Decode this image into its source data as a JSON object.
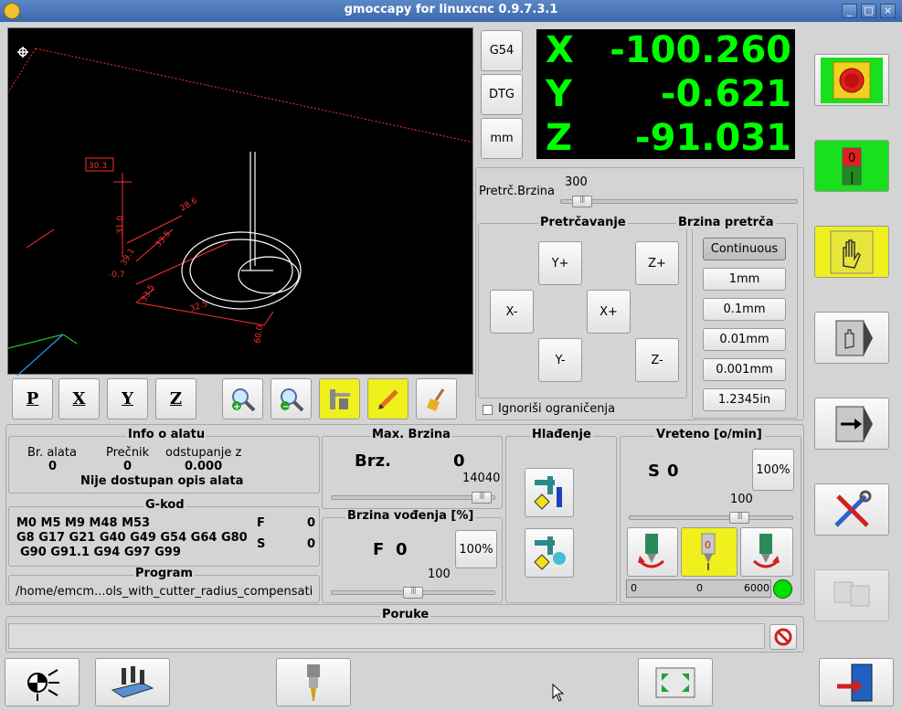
{
  "window": {
    "title": "gmoccapy for linuxcnc 0.9.7.3.1"
  },
  "preview": {
    "labels": [
      "30.3",
      "31.0",
      "28.6",
      "33.5",
      "32.5",
      "60.0",
      "-0.7",
      "39.1"
    ],
    "view_buttons": [
      "P",
      "X",
      "Y",
      "Z"
    ]
  },
  "coord_buttons": {
    "g54": "G54",
    "dtg": "DTG",
    "mm": "mm"
  },
  "dro": {
    "x": {
      "axis": "X",
      "value": "-100.260"
    },
    "y": {
      "axis": "Y",
      "value": "-0.621"
    },
    "z": {
      "axis": "Z",
      "value": "-91.031"
    }
  },
  "jog": {
    "speed_label": "Pretrč.Brzina",
    "speed_value": "300",
    "speed_fraction": 0.05,
    "title": "Pretrčavanje",
    "buttons": {
      "yplus": "Y+",
      "zplus": "Z+",
      "xminus": "X-",
      "xplus": "X+",
      "yminus": "Y-",
      "zminus": "Z-"
    },
    "increments_title": "Brzina pretrča",
    "increments": [
      "Continuous",
      "1mm",
      "0.1mm",
      "0.01mm",
      "0.001mm",
      "1.2345in"
    ],
    "ignore_limits": "Ignoriši ograničenja"
  },
  "tool_info": {
    "title": "Info o alatu",
    "headers": [
      "Br. alata",
      "Prečnik",
      "odstupanje z"
    ],
    "values": [
      "0",
      "0",
      "0.000"
    ],
    "description": "Nije dostupan opis alata"
  },
  "gcode": {
    "title": "G-kod",
    "line1": "M0 M5 M9 M48 M53",
    "line2": "G8 G17 G21 G40 G49 G54 G64 G80",
    "line3": "G90 G91.1 G94 G97 G99",
    "f_label": "F",
    "f_value": "0",
    "s_label": "S",
    "s_value": "0"
  },
  "program": {
    "title": "Program",
    "path": "/home/emcm...ols_with_cutter_radius_compensati"
  },
  "max_speed": {
    "title": "Max. Brzina",
    "label": "Brz.",
    "value": "0",
    "max": "14040",
    "fraction": 0.98
  },
  "feed": {
    "title": "Brzina vođenja [%]",
    "label": "F",
    "value": "0",
    "pct_button": "100%",
    "slider_value": "100",
    "fraction": 0.5
  },
  "coolant": {
    "title": "Hlađenje"
  },
  "spindle": {
    "title": "Vreteno [o/min]",
    "label": "S",
    "value": "0",
    "pct_button": "100%",
    "slider_value": "100",
    "fraction": 0.7,
    "bar_min": "0",
    "bar_mid": "0",
    "bar_max": "6000",
    "led_color": "#00e000"
  },
  "messages": {
    "title": "Poruke"
  },
  "colors": {
    "estop_green": "#18e01c",
    "machine_green": "#18e01c",
    "yellow": "#f0f01c",
    "dro_green": "#00ff00"
  }
}
